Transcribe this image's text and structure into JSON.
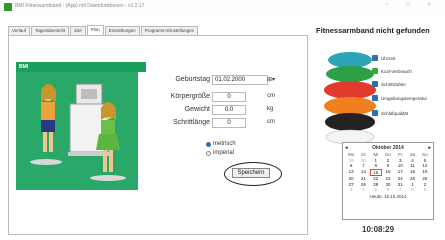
{
  "window": {
    "title": "BMI Fitnessarmband - (App) mit Datenfunktionen - v1.2.17"
  },
  "tabs": [
    {
      "label": "Verlauf"
    },
    {
      "label": "Tagesübersicht"
    },
    {
      "label": "Ziel"
    },
    {
      "label": "Plan"
    },
    {
      "label": "Einstellungen"
    },
    {
      "label": "Programm-Einstellungen"
    }
  ],
  "bmi": {
    "header": "BMI",
    "fields": [
      {
        "label": "Geburtstag",
        "value": "01.02.2000",
        "unit": "⊞▾"
      },
      {
        "label": "Körpergröße",
        "value": "0",
        "unit": "cm"
      },
      {
        "label": "Gewicht",
        "value": "0.0",
        "unit": "kg"
      },
      {
        "label": "Schrittlänge",
        "value": "0",
        "unit": "cm"
      }
    ],
    "unit_options": [
      {
        "label": "metrisch",
        "checked": true
      },
      {
        "label": "imperial",
        "checked": false
      }
    ],
    "save_label": "Speichern"
  },
  "ad": {
    "title": "Fitnessarmband nicht gefunden",
    "features": [
      {
        "label": "Uhrzeit",
        "color": "#2f6fb5"
      },
      {
        "label": "Kcal-Verbrauch",
        "color": "#e6a21e"
      },
      {
        "label": "Schrittzähler",
        "color": "#2f6fb5"
      },
      {
        "label": "Umgebungstemperatur",
        "color": "#2f6fb5"
      },
      {
        "label": "Schlafqualität",
        "color": "#2f6fb5"
      }
    ],
    "band_colors": [
      "#2ea4b8",
      "#2d9f46",
      "#e23b2e",
      "#f07f1f",
      "#222222",
      "#ffffff"
    ]
  },
  "calendar": {
    "month": "Oktober 2014",
    "prev": "◂",
    "next": "▸",
    "day_headers": [
      "Mo",
      "Di",
      "Mi",
      "Do",
      "Fr",
      "Sa",
      "So"
    ],
    "days": [
      "29",
      "30",
      "1",
      "2",
      "3",
      "4",
      "5",
      "6",
      "7",
      "8",
      "9",
      "10",
      "11",
      "12",
      "13",
      "14",
      "15",
      "16",
      "17",
      "18",
      "19",
      "20",
      "21",
      "22",
      "23",
      "24",
      "25",
      "26",
      "27",
      "28",
      "29",
      "30",
      "31",
      "1",
      "2",
      "3",
      "4",
      "5",
      "6",
      "7",
      "8",
      "9"
    ],
    "today_text": "Heute: 15.10.2014"
  },
  "clock": "10:08:29"
}
